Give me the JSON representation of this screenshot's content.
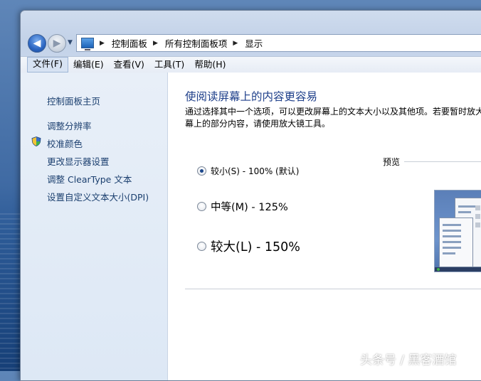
{
  "address": {
    "breadcrumbs": [
      "控制面板",
      "所有控制面板项",
      "显示"
    ]
  },
  "menu": {
    "items": [
      "文件(F)",
      "编辑(E)",
      "查看(V)",
      "工具(T)",
      "帮助(H)"
    ]
  },
  "sidebar": {
    "home": "控制面板主页",
    "links": [
      "调整分辨率",
      "校准颜色",
      "更改显示器设置",
      "调整 ClearType 文本",
      "设置自定义文本大小(DPI)"
    ]
  },
  "main": {
    "title": "使阅读屏幕上的内容更容易",
    "description": "通过选择其中一个选项，可以更改屏幕上的文本大小以及其他项。若要暂时放大屏幕上的部分内容，请使用放大镜工具。",
    "options": [
      {
        "label": "较小(S) - 100% (默认)",
        "checked": true
      },
      {
        "label": "中等(M) - 125%",
        "checked": false
      },
      {
        "label": "较大(L) - 150%",
        "checked": false
      }
    ],
    "preview_label": "预览"
  },
  "watermark": "头条号 / 黑客酒馆",
  "colors": {
    "title_blue": "#1e3f8a",
    "link_blue": "#1b3f6f",
    "left_pane": "#e3ebf6"
  }
}
